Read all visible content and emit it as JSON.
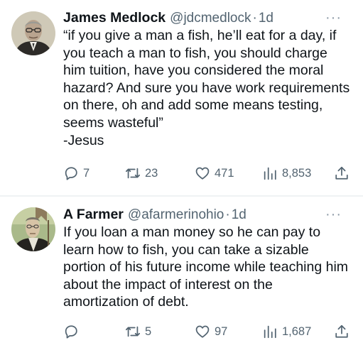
{
  "tweets": [
    {
      "name": "James Medlock",
      "handle": "@jdcmedlock",
      "separator": "·",
      "time": "1d",
      "more": "···",
      "text": "“if you give a man a fish, he’ll eat for a day, if you teach a man to fish, you should charge him tuition, have you considered the moral hazard? And sure you have work requirements on there, oh and add some means testing, seems wasteful”\n-Jesus",
      "replies": "7",
      "reposts": "23",
      "likes": "471",
      "views": "8,853"
    },
    {
      "name": "A Farmer",
      "handle": "@afarmerinohio",
      "separator": "·",
      "time": "1d",
      "more": "···",
      "text": "If you loan a man money so he can pay to learn how to fish, you can take a sizable portion of his future income while teaching him about the impact of interest on the amortization of debt.",
      "replies": "",
      "reposts": "5",
      "likes": "97",
      "views": "1,687"
    }
  ],
  "icons": {
    "reply": "reply-icon",
    "repost": "repost-icon",
    "like": "heart-icon",
    "views": "views-chart-icon",
    "share": "share-icon",
    "more": "more-dots-icon"
  },
  "colors": {
    "text": "#0f1419",
    "secondary": "#536471",
    "divider": "#eff3f4"
  }
}
